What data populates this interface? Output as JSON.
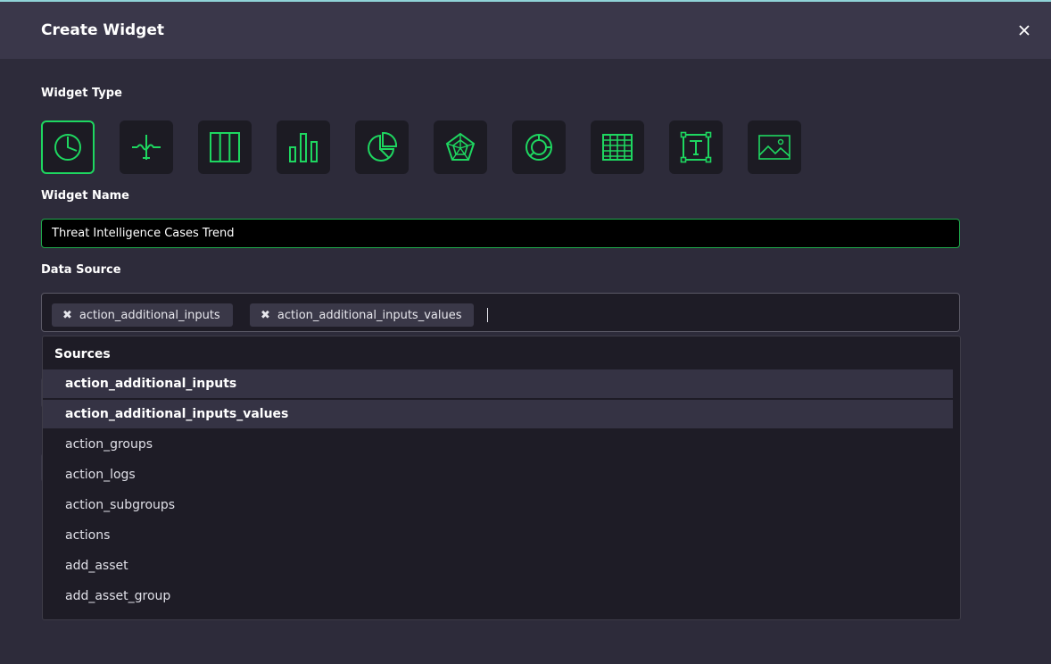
{
  "modal": {
    "title": "Create Widget",
    "close_icon": "close-icon"
  },
  "widget_type": {
    "label": "Widget Type",
    "types": [
      {
        "icon": "clock-pie-icon",
        "active": true
      },
      {
        "icon": "signal-line-icon",
        "active": false
      },
      {
        "icon": "columns-icon",
        "active": false
      },
      {
        "icon": "bar-chart-icon",
        "active": false
      },
      {
        "icon": "pie-chart-icon",
        "active": false
      },
      {
        "icon": "radar-chart-icon",
        "active": false
      },
      {
        "icon": "donut-chart-icon",
        "active": false
      },
      {
        "icon": "table-icon",
        "active": false
      },
      {
        "icon": "text-box-icon",
        "active": false
      },
      {
        "icon": "image-icon",
        "active": false
      }
    ],
    "accent": "#1ed760"
  },
  "widget_name": {
    "label": "Widget Name",
    "value": "Threat Intelligence Cases Trend"
  },
  "data_source": {
    "label": "Data Source",
    "chips": [
      {
        "text": "action_additional_inputs",
        "remove": "✖"
      },
      {
        "text": "action_additional_inputs_values",
        "remove": "✖"
      }
    ],
    "dropdown": {
      "header": "Sources",
      "items": [
        {
          "text": "action_additional_inputs",
          "selected": true
        },
        {
          "text": "action_additional_inputs_values",
          "selected": true
        },
        {
          "text": "action_groups",
          "selected": false
        },
        {
          "text": "action_logs",
          "selected": false
        },
        {
          "text": "action_subgroups",
          "selected": false
        },
        {
          "text": "actions",
          "selected": false
        },
        {
          "text": "add_asset",
          "selected": false
        },
        {
          "text": "add_asset_group",
          "selected": false
        }
      ]
    }
  }
}
